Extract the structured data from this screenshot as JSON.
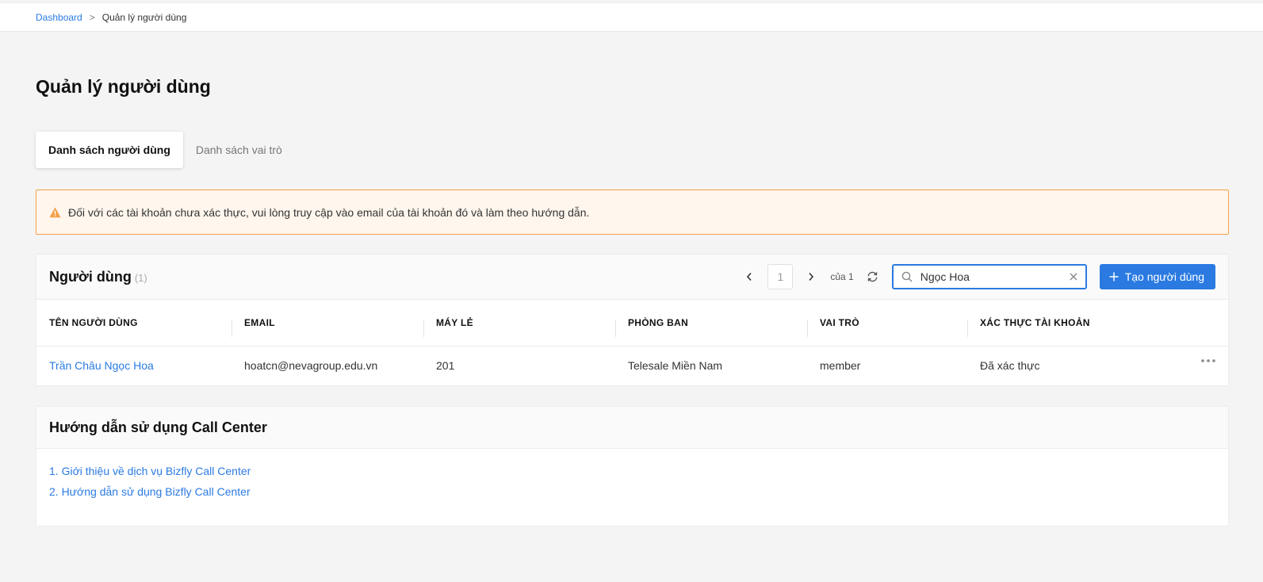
{
  "breadcrumb": {
    "home": "Dashboard",
    "separator": ">",
    "current": "Quản lý người dùng"
  },
  "page": {
    "title": "Quản lý người dùng"
  },
  "tabs": [
    {
      "label": "Danh sách người dùng",
      "active": true
    },
    {
      "label": "Danh sách vai trò",
      "active": false
    }
  ],
  "alert": {
    "icon": "warning-triangle-icon",
    "color": "#f5a047",
    "text": "Đối với các tài khoản chưa xác thực, vui lòng truy cập vào email của tài khoản đó và làm theo hướng dẫn."
  },
  "users_card": {
    "title": "Người dùng",
    "count": "(1)",
    "pager": {
      "page": "1",
      "of_label": "của 1"
    },
    "search": {
      "value": "Ngọc Hoa",
      "placeholder": ""
    },
    "create_label": "Tạo người dùng",
    "accent": "#2a7ae2",
    "columns": [
      "TÊN NGƯỜI DÙNG",
      "EMAIL",
      "MÁY LẺ",
      "PHÒNG BAN",
      "VAI TRÒ",
      "XÁC THỰC TÀI KHOẢN"
    ],
    "rows": [
      {
        "name": "Trần Châu Ngọc Hoa",
        "email": "hoatcn@nevagroup.edu.vn",
        "extension": "201",
        "department": "Telesale Miền Nam",
        "role": "member",
        "verified": "Đã xác thực"
      }
    ]
  },
  "guide_card": {
    "title": "Hướng dẫn sử dụng Call Center",
    "links": [
      "1. Giới thiệu về dịch vụ Bizfly Call Center",
      "2. Hướng dẫn sử dụng Bizfly Call Center"
    ]
  }
}
